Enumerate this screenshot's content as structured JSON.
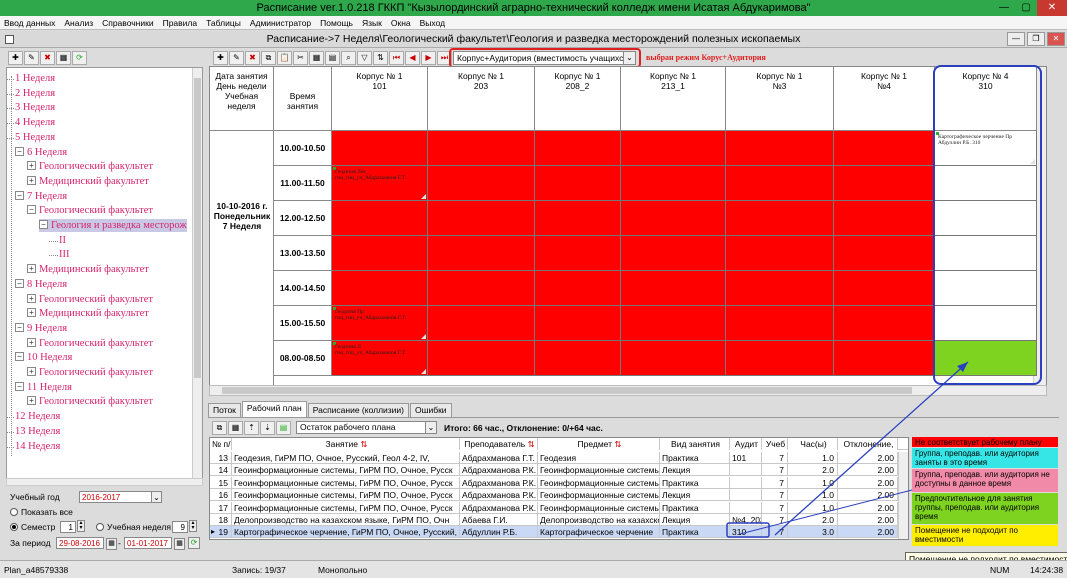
{
  "app": {
    "title": "Расписание ver.1.0.218 ГККП \"Кызылординский аграрно-технический колледж имени Исатая Абдукаримова\"",
    "window_min": "—",
    "window_max": "▢",
    "window_close": "✕"
  },
  "menu": [
    "Ввод данных",
    "Анализ",
    "Справочники",
    "Правила",
    "Таблицы",
    "Администратор",
    "Помощь",
    "Язык",
    "Окна",
    "Выход"
  ],
  "inner_title": "Расписание->7 Неделя\\Геологический факультет\\Геология и разведка месторождений полезных ископаемых",
  "mode": {
    "selected": "Корпус+Аудитория (вместимость учащихся)",
    "annotation": "выбран режим Корус+Аудитория"
  },
  "tree": [
    {
      "label": "1 Неделя",
      "level": 0
    },
    {
      "label": "2 Неделя",
      "level": 0
    },
    {
      "label": "3 Неделя",
      "level": 0
    },
    {
      "label": "4 Неделя",
      "level": 0
    },
    {
      "label": "5 Неделя",
      "level": 0
    },
    {
      "label": "6 Неделя",
      "level": 0,
      "pm": "−"
    },
    {
      "label": "Геологический факультет",
      "level": 1,
      "pm": "+"
    },
    {
      "label": "Медицинский факультет",
      "level": 1,
      "pm": "+"
    },
    {
      "label": "7 Неделя",
      "level": 0,
      "pm": "−"
    },
    {
      "label": "Геологический факультет",
      "level": 1,
      "pm": "−"
    },
    {
      "label": "Геология и разведка месторож",
      "level": 2,
      "pm": "−",
      "sel": true
    },
    {
      "label": "II",
      "level": 3
    },
    {
      "label": "III",
      "level": 3
    },
    {
      "label": "Медицинский факультет",
      "level": 1,
      "pm": "+"
    },
    {
      "label": "8 Неделя",
      "level": 0,
      "pm": "−"
    },
    {
      "label": "Геологический факультет",
      "level": 1,
      "pm": "+"
    },
    {
      "label": "Медицинский факультет",
      "level": 1,
      "pm": "+"
    },
    {
      "label": "9 Неделя",
      "level": 0,
      "pm": "−"
    },
    {
      "label": "Геологический факультет",
      "level": 1,
      "pm": "+"
    },
    {
      "label": "10 Неделя",
      "level": 0,
      "pm": "−"
    },
    {
      "label": "Геологический факультет",
      "level": 1,
      "pm": "+"
    },
    {
      "label": "11 Неделя",
      "level": 0,
      "pm": "−"
    },
    {
      "label": "Геологический факультет",
      "level": 1,
      "pm": "+"
    },
    {
      "label": "12 Неделя",
      "level": 0
    },
    {
      "label": "13 Неделя",
      "level": 0
    },
    {
      "label": "14 Неделя",
      "level": 0
    }
  ],
  "controls": {
    "year_label": "Учебный год",
    "year_value": "2016-2017",
    "show_all": "Показать все",
    "semester_label": "Семестр",
    "semester_value": "1",
    "week_label": "Учебная неделя",
    "week_value": "9",
    "period_label": "За период",
    "date_from": "29-08-2016",
    "date_to": "01-01-2017"
  },
  "grid": {
    "col0_header": "Дата занятия День недели Учебная неделя",
    "col1_header": "Время занятия",
    "rooms": [
      {
        "line1": "Корпус № 1",
        "line2": "101"
      },
      {
        "line1": "Корпус № 1",
        "line2": "203"
      },
      {
        "line1": "Корпус № 1",
        "line2": "208_2"
      },
      {
        "line1": "Корпус № 1",
        "line2": "213_1"
      },
      {
        "line1": "Корпус № 1",
        "line2": "№3"
      },
      {
        "line1": "Корпус № 1",
        "line2": "№4"
      },
      {
        "line1": "Корпус № 4",
        "line2": "310"
      }
    ],
    "day_label": [
      "10-10-2016 г.",
      "Понедельник",
      "7 Неделя"
    ],
    "times": [
      "10.00-10.50",
      "11.00-11.50",
      "12.00-12.50",
      "13.00-13.50",
      "14.00-14.50",
      "15.00-15.50",
      "08.00-08.50"
    ],
    "cell_notes": {
      "r1c0": "Геодезия Лек_ гиц_гиц_уч_Абдрахманов Г.Т.",
      "r5c0": "Геодезия Пр гиц_гиц_уч_Абдрахманов Г.Т.",
      "r6c0": "Геодезия Л гиц_гиц_уч_Абдрахманов Г.Т.",
      "r0c6": "Картографическое черчение Пр Абдуллин Р.Б. 310"
    }
  },
  "tabs": [
    "Поток",
    "Рабочий план",
    "Расписание (коллизии)",
    "Ошибки"
  ],
  "work_plan": {
    "filter": "Остаток рабочего плана",
    "summary": "Итого: 66 час., Отклонение: 0/+64 час.",
    "columns": [
      "№ п/п",
      "Занятие",
      "Преподаватель",
      "Предмет",
      "Вид занятия",
      "Аудит",
      "Учеб",
      "Час(ы)",
      "Отклонение,"
    ],
    "rows": [
      [
        "13",
        "Геодезия, ГиРМ ПО, Очное, Русский, Геол 4-2, IV,",
        "Абдрахманова Г.Т.",
        "Геодезия",
        "Практика",
        "101",
        "7",
        "1.0",
        "2.00"
      ],
      [
        "14",
        "Геоинформационные системы, ГиРМ ПО, Очное, Русск",
        "Абдрахманова Р.К.",
        "Геоинформационные системы",
        "Лекция",
        "",
        "7",
        "2.0",
        "2.00"
      ],
      [
        "15",
        "Геоинформационные системы, ГиРМ ПО, Очное, Русск",
        "Абдрахманова Р.К.",
        "Геоинформационные системы",
        "Практика",
        "",
        "7",
        "1.0",
        "2.00"
      ],
      [
        "16",
        "Геоинформационные системы, ГиРМ ПО, Очное, Русск",
        "Абдрахманова Р.К.",
        "Геоинформационные системы",
        "Лекция",
        "",
        "7",
        "1.0",
        "2.00"
      ],
      [
        "17",
        "Геоинформационные системы, ГиРМ ПО, Очное, Русск",
        "Абдрахманова Р.К.",
        "Геоинформационные системы",
        "Практика",
        "",
        "7",
        "1.0",
        "2.00"
      ],
      [
        "18",
        "Делопроизводство на казахском языке, ГиРМ ПО, Очн",
        "Абаева Г.И.",
        "Делопроизводство на казахско",
        "Лекция",
        "№4, 203,",
        "7",
        "2.0",
        "2.00"
      ],
      [
        "19",
        "Картографическое черчение, ГиРМ ПО, Очное, Русский,",
        "Абдуллин Р.Б.",
        "Картографическое черчение",
        "Практика",
        "310",
        "7",
        "3.0",
        "2.00"
      ]
    ],
    "selected_row_marker": "▸"
  },
  "legend": [
    {
      "text": "Не соответствует рабочему плану",
      "color": "#fe0000"
    },
    {
      "text": "Группа, преподав. или аудитория заняты в это время",
      "color": "#36e6e6"
    },
    {
      "text": "Группа, преподав. или аудитория не доступны в данное время",
      "color": "#f08aa8"
    },
    {
      "text": "Предпочтительное для занятия группы, преподав. или аудитория время",
      "color": "#7ed321"
    },
    {
      "text": "Помещение не подходит по вместимости",
      "color": "#ffee00"
    }
  ],
  "tooltip": "Помещение не подходит по вместимости",
  "status": {
    "user": "Plan_a48579338",
    "record": "Запись: 19/37",
    "mode": "Монопольно",
    "num": "NUM",
    "time": "14:24:38"
  }
}
